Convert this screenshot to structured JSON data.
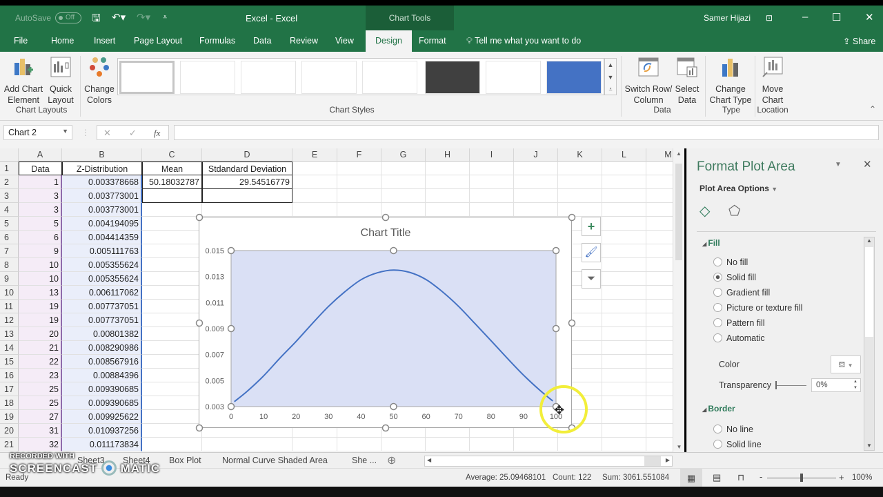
{
  "titlebar": {
    "autosave_label": "AutoSave",
    "autosave_state": "Off",
    "window_title": "Excel  -  Excel",
    "context_tab_group": "Chart Tools",
    "user_name": "Samer Hijazi"
  },
  "tabs": [
    {
      "label": "File"
    },
    {
      "label": "Home"
    },
    {
      "label": "Insert"
    },
    {
      "label": "Page Layout"
    },
    {
      "label": "Formulas"
    },
    {
      "label": "Data"
    },
    {
      "label": "Review"
    },
    {
      "label": "View"
    },
    {
      "label": "Design",
      "active": true
    },
    {
      "label": "Format"
    }
  ],
  "tell_me": "Tell me what you want to do",
  "share_label": "Share",
  "ribbon": {
    "add_chart_element": "Add Chart Element",
    "quick_layout": "Quick Layout",
    "change_colors": "Change Colors",
    "group_chart_layouts": "Chart Layouts",
    "group_chart_styles": "Chart Styles",
    "switch_row_column": "Switch Row/ Column",
    "select_data": "Select Data",
    "group_data": "Data",
    "change_chart_type": "Change Chart Type",
    "group_type": "Type",
    "move_chart": "Move Chart",
    "group_location": "Location"
  },
  "formula_bar": {
    "name_box": "Chart 2",
    "cancel_icon": "✕",
    "enter_icon": "✓",
    "fx_label": "fx",
    "formula": ""
  },
  "sheet": {
    "columns": [
      "A",
      "B",
      "C",
      "D",
      "E",
      "F",
      "G",
      "H",
      "I",
      "J",
      "K",
      "L",
      "M"
    ],
    "header_row": {
      "A": "Data",
      "B": "Z-Distribution",
      "C": "Mean",
      "D": "Stdandard Deviation"
    },
    "mean_value": "50.18032787",
    "sd_value": "29.54516779",
    "rows": [
      {
        "n": "2",
        "a": "1",
        "b": "0.003378668"
      },
      {
        "n": "3",
        "a": "3",
        "b": "0.003773001"
      },
      {
        "n": "4",
        "a": "3",
        "b": "0.003773001"
      },
      {
        "n": "5",
        "a": "5",
        "b": "0.004194095"
      },
      {
        "n": "6",
        "a": "6",
        "b": "0.004414359"
      },
      {
        "n": "7",
        "a": "9",
        "b": "0.005111763"
      },
      {
        "n": "8",
        "a": "10",
        "b": "0.005355624"
      },
      {
        "n": "9",
        "a": "10",
        "b": "0.005355624"
      },
      {
        "n": "10",
        "a": "13",
        "b": "0.006117062"
      },
      {
        "n": "11",
        "a": "19",
        "b": "0.007737051"
      },
      {
        "n": "12",
        "a": "19",
        "b": "0.007737051"
      },
      {
        "n": "13",
        "a": "20",
        "b": "0.00801382"
      },
      {
        "n": "14",
        "a": "21",
        "b": "0.008290986"
      },
      {
        "n": "15",
        "a": "22",
        "b": "0.008567916"
      },
      {
        "n": "16",
        "a": "23",
        "b": "0.00884396"
      },
      {
        "n": "17",
        "a": "25",
        "b": "0.009390685"
      },
      {
        "n": "18",
        "a": "25",
        "b": "0.009390685"
      },
      {
        "n": "19",
        "a": "27",
        "b": "0.009925622"
      },
      {
        "n": "20",
        "a": "31",
        "b": "0.010937256"
      },
      {
        "n": "21",
        "a": "32",
        "b": "0.011173834"
      }
    ]
  },
  "chart_data": {
    "type": "line",
    "title": "Chart Title",
    "xlabel": "",
    "ylabel": "",
    "xlim": [
      0,
      100
    ],
    "ylim": [
      0.003,
      0.015
    ],
    "x_ticks": [
      "0",
      "10",
      "20",
      "30",
      "40",
      "50",
      "60",
      "70",
      "80",
      "90",
      "100"
    ],
    "y_ticks": [
      "0.003",
      "0.005",
      "0.007",
      "0.009",
      "0.011",
      "0.013",
      "0.015"
    ],
    "grid": false,
    "plot_area_fill": "#dae0f5",
    "line_color": "#4472c4",
    "series": [
      {
        "name": "Z-Distribution",
        "x": [
          1,
          5,
          10,
          15,
          20,
          25,
          30,
          35,
          40,
          45,
          50,
          55,
          60,
          65,
          70,
          75,
          80,
          85,
          90,
          95,
          99
        ],
        "values": [
          0.00338,
          0.00419,
          0.00536,
          0.00672,
          0.00801,
          0.00939,
          0.01071,
          0.01183,
          0.01276,
          0.01329,
          0.0135,
          0.01332,
          0.01277,
          0.01184,
          0.01071,
          0.0094,
          0.00807,
          0.00672,
          0.00542,
          0.00426,
          0.00343
        ]
      }
    ]
  },
  "chart_side_buttons": [
    "chart-elements",
    "chart-styles",
    "chart-filters"
  ],
  "format_pane": {
    "title": "Format Plot Area",
    "options_label": "Plot Area Options",
    "fill_section": "Fill",
    "fill_options": [
      {
        "label": "No fill",
        "selected": false
      },
      {
        "label": "Solid fill",
        "selected": true
      },
      {
        "label": "Gradient fill",
        "selected": false
      },
      {
        "label": "Picture or texture fill",
        "selected": false
      },
      {
        "label": "Pattern fill",
        "selected": false
      },
      {
        "label": "Automatic",
        "selected": false
      }
    ],
    "color_label": "Color",
    "transparency_label": "Transparency",
    "transparency_value": "0%",
    "border_section": "Border",
    "border_options": [
      {
        "label": "No line",
        "selected": false
      },
      {
        "label": "Solid line",
        "selected": false
      }
    ]
  },
  "sheet_tabs": [
    "Sheet3",
    "Sheet4",
    "Box Plot",
    "Normal Curve Shaded Area",
    "She ..."
  ],
  "status": {
    "ready": "Ready",
    "average": "Average: 25.09468101",
    "count": "Count: 122",
    "sum": "Sum: 3061.551084",
    "zoom": "100%"
  },
  "watermark": {
    "line1": "RECORDED WITH",
    "line2": "SCREENCAST",
    "line3": "MATIC"
  },
  "colors": {
    "excel_green": "#217346",
    "accent_blue": "#4472c4"
  }
}
